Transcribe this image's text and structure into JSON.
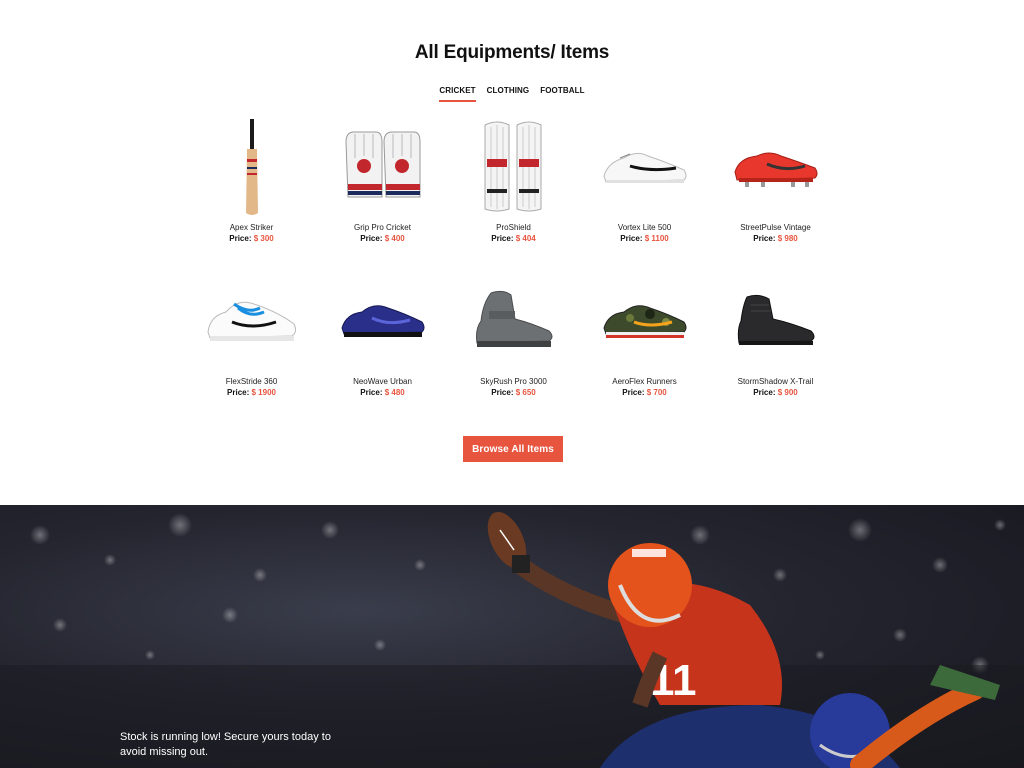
{
  "section": {
    "title": "All Equipments/ Items"
  },
  "tabs": [
    {
      "label": "CRICKET",
      "active": true
    },
    {
      "label": "CLOTHING",
      "active": false
    },
    {
      "label": "FOOTBALL",
      "active": false
    }
  ],
  "price_label": "Price:",
  "products": [
    {
      "name": "Apex Striker",
      "price": "$ 300",
      "icon": "cricket-bat-icon"
    },
    {
      "name": "Grip Pro Cricket",
      "price": "$ 400",
      "icon": "batting-gloves-icon"
    },
    {
      "name": "ProShield",
      "price": "$ 404",
      "icon": "batting-pads-icon"
    },
    {
      "name": "Vortex Lite 500",
      "price": "$ 1100",
      "icon": "spike-shoe-icon"
    },
    {
      "name": "StreetPulse Vintage",
      "price": "$ 980",
      "icon": "football-boot-icon"
    },
    {
      "name": "FlexStride 360",
      "price": "$ 1900",
      "icon": "tennis-shoe-icon"
    },
    {
      "name": "NeoWave Urban",
      "price": "$ 480",
      "icon": "running-shoe-icon"
    },
    {
      "name": "SkyRush Pro 3000",
      "price": "$ 650",
      "icon": "high-top-sneaker-icon"
    },
    {
      "name": "AeroFlex Runners",
      "price": "$ 700",
      "icon": "camo-runner-icon"
    },
    {
      "name": "StormShadow X-Trail",
      "price": "$ 900",
      "icon": "black-high-top-icon"
    }
  ],
  "browse_button": "Browse All Items",
  "hero": {
    "text": "Stock is running low! Secure yours today to avoid missing out."
  },
  "colors": {
    "accent": "#e8553f",
    "hero_bg": "#24252f"
  }
}
